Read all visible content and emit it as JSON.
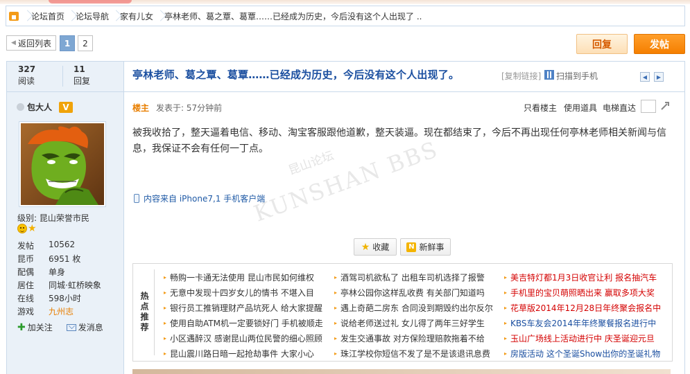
{
  "breadcrumb": {
    "items": [
      "论坛首页",
      "论坛导航",
      "家有儿女",
      "亭林老师、葛之覃、葛覃……已经成为历史，今后没有这个人出现了 .."
    ]
  },
  "toolbar": {
    "back_label": "返回列表",
    "pages": [
      "1",
      "2"
    ],
    "current_page": "1",
    "reply_label": "回复",
    "post_label": "发帖"
  },
  "stats": {
    "views_num": "327",
    "views_label": "阅读",
    "replies_num": "11",
    "replies_label": "回复"
  },
  "thread": {
    "title": "亭林老师、葛之覃、葛覃……已经成为历史，今后没有这个人出现了。",
    "copy_link": "[复制链接]",
    "scan_label": "扫描到手机"
  },
  "author": {
    "name": "包大人",
    "vip": "V",
    "level": "级别: 昆山荣誉市民",
    "profile": [
      {
        "key": "发帖",
        "value": "10562"
      },
      {
        "key": "昆币",
        "value": "6951 枚"
      },
      {
        "key": "配偶",
        "value": "单身"
      },
      {
        "key": "居住",
        "value": "同城·虹桥映象"
      },
      {
        "key": "在线",
        "value": "598小时"
      },
      {
        "key": "游戏",
        "value": "九州志"
      }
    ],
    "follow_label": "加关注",
    "message_label": "发消息"
  },
  "post": {
    "owner_tag": "楼主",
    "posted_at": "发表于: 57分钟前",
    "tool_only_owner": "只看楼主",
    "tool_use_item": "使用道具",
    "tool_elevator": "电梯直达",
    "body": "被我收拾了，整天逼着电信、移动、淘宝客服跟他道歉，整天装逼。现在都结束了，今后不再出现任何亭林老师相关新闻与信息，我保证不会有任何一丁点。",
    "from_client": "内容来自 iPhone7,1 手机客户端",
    "fav_label": "收藏",
    "fresh_label": "新鲜事",
    "watermark_main": "KUNSHAN BBS",
    "watermark_sub": "昆山论坛"
  },
  "hot": {
    "label": "热点推荐",
    "col1": [
      {
        "text": "畅购一卡通无法使用 昆山市民如何维权",
        "color": "normal"
      },
      {
        "text": "无意中发现十四岁女儿的情书 不堪入目",
        "color": "normal"
      },
      {
        "text": "银行员工推销理财产品坑死人 给大家提醒",
        "color": "normal"
      },
      {
        "text": "使用自助ATM机一定要锁好门 手机被顺走",
        "color": "normal"
      },
      {
        "text": "小区遇醉汉 感谢昆山两位民警的细心照顾",
        "color": "normal"
      },
      {
        "text": "昆山震川路日暗一起抢劫事件 大家小心",
        "color": "normal"
      }
    ],
    "col2": [
      {
        "text": "酒驾司机欲私了 出租车司机选择了报警",
        "color": "normal"
      },
      {
        "text": "亭林公园你这样乱收费 有关部门知道吗",
        "color": "normal"
      },
      {
        "text": "遇上奇葩二房东 合同没到期毁约出尔反尔",
        "color": "normal"
      },
      {
        "text": "说给老师送过礼 女儿得了两年三好学生",
        "color": "normal"
      },
      {
        "text": "发生交通事故 对方保险理赔款拖着不给",
        "color": "normal"
      },
      {
        "text": "珠江学校你短信不发了是不是该退讯息费",
        "color": "normal"
      }
    ],
    "col3": [
      {
        "text": "美吉特灯都1月3日收官让利 报名抽汽车",
        "color": "red"
      },
      {
        "text": "手机里的宝贝萌照晒出来 赢取多项大奖",
        "color": "red"
      },
      {
        "text": "花草版2014年12月28日年终聚会报名中",
        "color": "red"
      },
      {
        "text": "KBS车友会2014年年终聚餐报名进行中",
        "color": "blue"
      },
      {
        "text": "玉山广场线上活动进行中 庆圣诞迎元旦",
        "color": "red"
      },
      {
        "text": "房版活动 这个圣诞Show出你的圣诞礼物",
        "color": "blue"
      }
    ]
  },
  "colors": {
    "accent_blue": "#1b4fa0",
    "orange": "#e87e00",
    "post_button": "#f57f00",
    "border": "#c9d9ea",
    "panel": "#eaf1f8"
  }
}
